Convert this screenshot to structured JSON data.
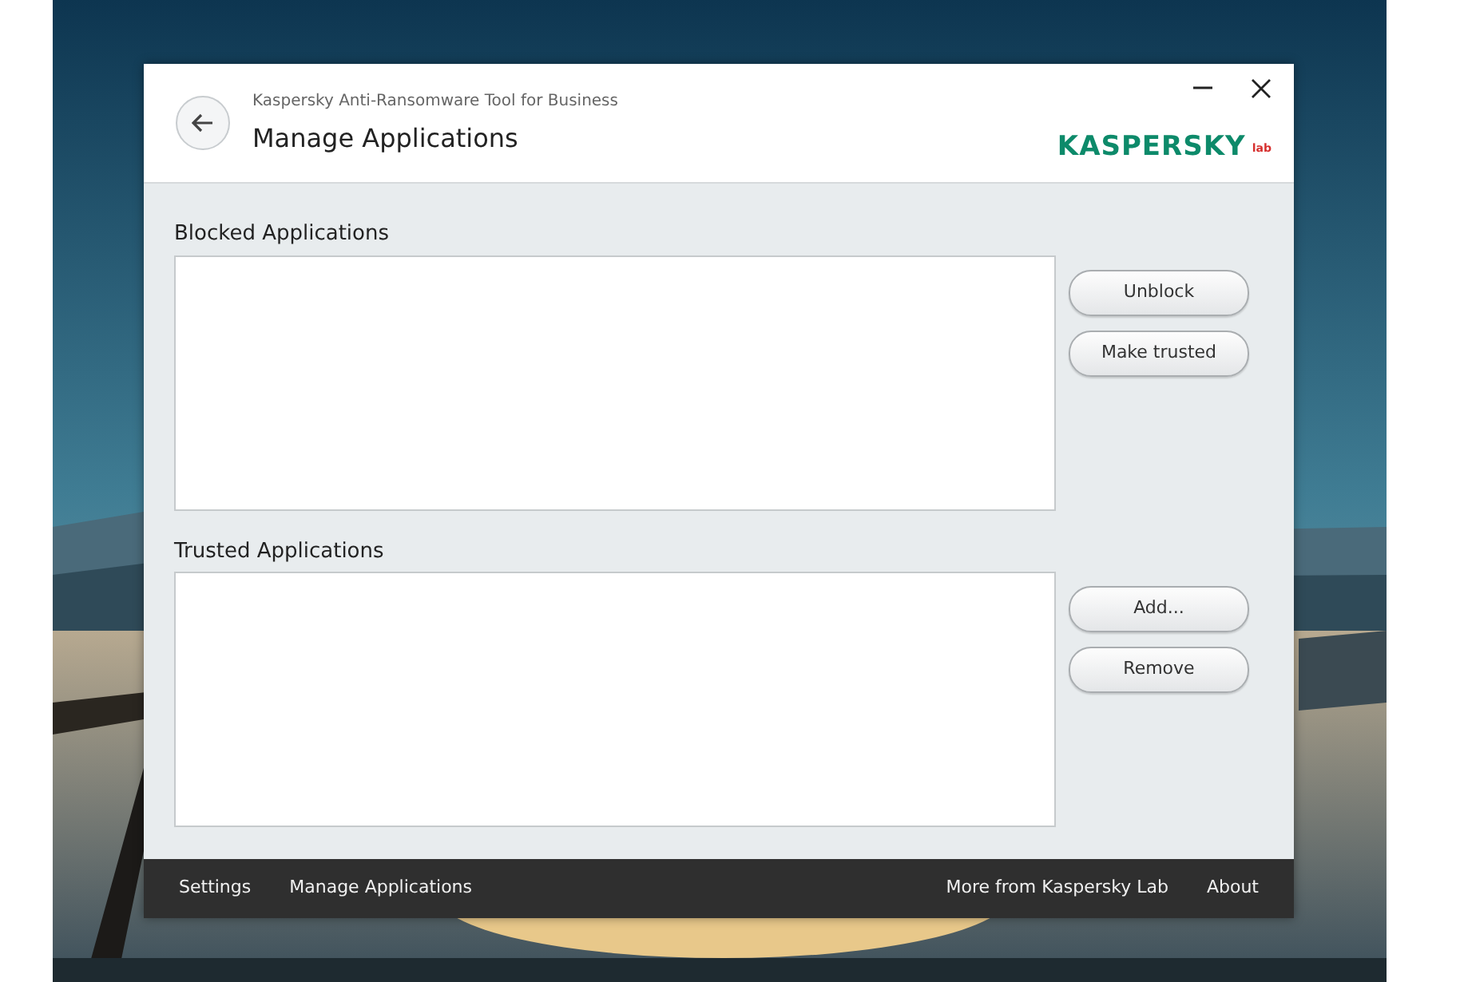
{
  "window": {
    "app_name": "Kaspersky Anti-Ransomware Tool for Business",
    "title": "Manage Applications",
    "logo": {
      "name": "KASPERSKY",
      "suffix": "lab"
    }
  },
  "sections": [
    {
      "label": "Blocked Applications",
      "buttons": [
        "Unblock",
        "Make trusted"
      ]
    },
    {
      "label": "Trusted Applications",
      "buttons": [
        "Add...",
        "Remove"
      ]
    }
  ],
  "footer": {
    "left": [
      "Settings",
      "Manage Applications"
    ],
    "right": [
      "More from Kaspersky Lab",
      "About"
    ]
  }
}
